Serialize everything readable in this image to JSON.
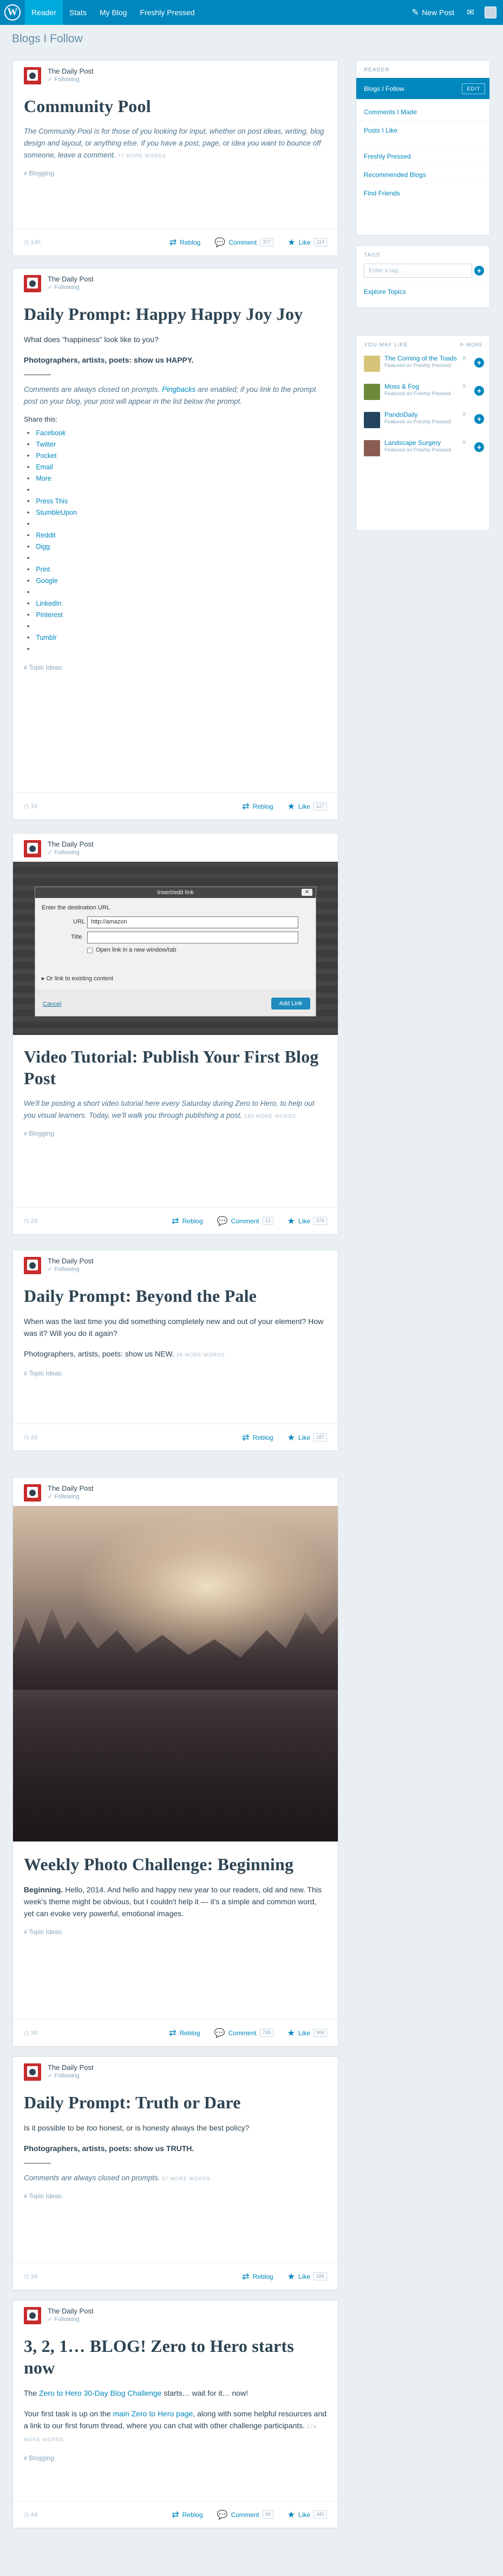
{
  "masterbar": {
    "reader": "Reader",
    "stats": "Stats",
    "my_blog": "My Blog",
    "freshly_pressed": "Freshly Pressed",
    "new_post": "New Post"
  },
  "page_title": "Blogs I Follow",
  "posts": [
    {
      "site": "The Daily Post",
      "following": "Following",
      "title": "Community Pool",
      "excerpt": "The Community Pool is for those of you looking for input, whether on post ideas, writing, blog design and layout, or anything else. If you have a post, page, or idea you want to bounce off someone, leave a comment.",
      "more": "77 MORE WORDS",
      "tag": "Blogging",
      "stat": "14h",
      "reblog": "Reblog",
      "comment": "Comment",
      "comment_count": "377",
      "like": "Like",
      "like_count": "114"
    },
    {
      "site": "The Daily Post",
      "following": "Following",
      "title": "Daily Prompt: Happy Happy Joy Joy",
      "p1": "What does \"happiness\" look like to you?",
      "p2": "Photographers, artists, poets: show us HAPPY.",
      "p3_a": "Comments are always closed on prompts.",
      "p3_link": "Pingbacks",
      "p3_b": "are enabled; if you link to the prompt post on your blog, your post will appear in the list below the prompt.",
      "share_title": "Share this:",
      "share": [
        "Facebook",
        "Twitter",
        "Pocket",
        "Email",
        "More",
        "",
        "Press This",
        "StumbleUpon",
        "",
        "Reddit",
        "Digg",
        "",
        "Print",
        "Google",
        "",
        "LinkedIn",
        "Pinterest",
        "",
        "Tumblr",
        ""
      ],
      "tag": "Topic Ideas",
      "stat": "10",
      "reblog": "Reblog",
      "like": "Like",
      "like_count": "127"
    },
    {
      "site": "The Daily Post",
      "following": "Following",
      "dialog": {
        "title": "Insert/edit link",
        "prompt": "Enter the destination URL",
        "url_label": "URL",
        "url_value": "http://amazon",
        "title_label": "Title",
        "newtab": "Open link in a new window/tab",
        "existing": "Or link to existing content",
        "cancel": "Cancel",
        "add": "Add Link"
      },
      "title": "Video Tutorial: Publish Your First Blog Post",
      "excerpt": "We'll be posting a short video tutorial here every Saturday during Zero to Hero, to help out you visual learners. Today, we'll walk you through publishing a post.",
      "more": "180 MORE WORDS",
      "tag": "Blogging",
      "stat": "2d",
      "reblog": "Reblog",
      "comment": "Comment",
      "comment_count": "13",
      "like": "Like",
      "like_count": "376"
    },
    {
      "site": "The Daily Post",
      "following": "Following",
      "title": "Daily Prompt: Beyond the Pale",
      "p1": "When was the last time you did something completely new and out of your element? How was it? Will you do it again?",
      "p2": "Photographers, artists, poets: show us NEW.",
      "more": "28 MORE WORDS",
      "tag": "Topic Ideas",
      "stat": "2d",
      "reblog": "Reblog",
      "like": "Like",
      "like_count": "187"
    },
    {
      "site": "The Daily Post",
      "following": "Following",
      "title": "Weekly Photo Challenge: Beginning",
      "p1_bold": "Beginning.",
      "p1": "Hello, 2014. And hello and happy new year to our readers, old and new. This week's theme might be obvious, but I couldn't help it — it's a simple and common word, yet can evoke very powerful, emotional images.",
      "tag": "Topic Ideas",
      "stat": "3d",
      "reblog": "Reblog",
      "comment": "Comment",
      "comment_count": "748",
      "like": "Like",
      "like_count": "906"
    },
    {
      "site": "The Daily Post",
      "following": "Following",
      "title": "Daily Prompt: Truth or Dare",
      "p1_a": "Is it possible to be",
      "p1_em": "too",
      "p1_b": "honest, or is honesty always the best policy?",
      "p2": "Photographers, artists, poets: show us TRUTH.",
      "p3": "Comments are always closed on prompts.",
      "more": "37 MORE WORDS",
      "tag": "Topic Ideas",
      "stat": "3d",
      "reblog": "Reblog",
      "like": "Like",
      "like_count": "186"
    },
    {
      "site": "The Daily Post",
      "following": "Following",
      "title": "3, 2, 1… BLOG! Zero to Hero starts now",
      "p1_a": "The",
      "p1_link": "Zero to Hero 30-Day Blog Challenge",
      "p1_b": "starts… wait for it… now!",
      "p2_a": "Your first task is up on the",
      "p2_link": "main Zero to Hero page",
      "p2_b": ", along with some helpful resources and a link to our first forum thread, where you can chat with other challenge participants.",
      "more": "274 MORE WORDS",
      "tag": "Blogging",
      "stat": "4d",
      "reblog": "Reblog",
      "comment": "Comment",
      "comment_count": "99",
      "like": "Like",
      "like_count": "480"
    }
  ],
  "sidebar": {
    "reader_head": "READER",
    "blogs_follow": "Blogs I Follow",
    "edit": "EDIT",
    "comments_made": "Comments I Made",
    "posts_like": "Posts I Like",
    "freshly_pressed": "Freshly Pressed",
    "recommended": "Recommended Blogs",
    "find_friends": "Find Friends",
    "tags_head": "TAGS",
    "tag_placeholder": "Enter a tag...",
    "explore_topics": "Explore Topics",
    "may_like_head": "YOU MAY LIKE",
    "more": "MORE",
    "recs": [
      {
        "title": "The Coming of the Toads",
        "sub": "Featured on Freshly Pressed",
        "color": "#d7c47a"
      },
      {
        "title": "Moss & Fog",
        "sub": "Featured on Freshly Pressed",
        "color": "#6c8a3a"
      },
      {
        "title": "PandoDaily",
        "sub": "Featured on Freshly Pressed",
        "color": "#24435e"
      },
      {
        "title": "Landscape Surgery",
        "sub": "Featured on Freshly Pressed",
        "color": "#8b5d52"
      }
    ]
  }
}
